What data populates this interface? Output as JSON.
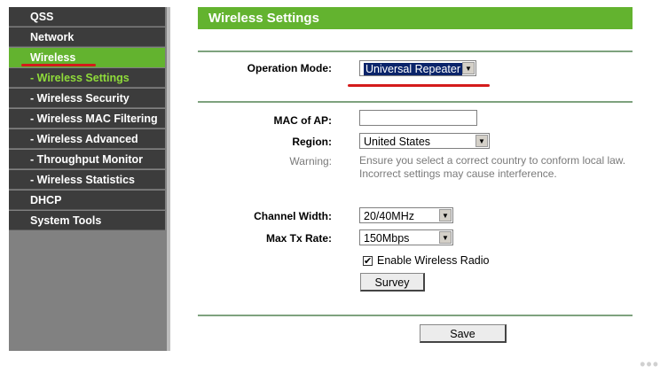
{
  "sidebar": {
    "items": [
      {
        "label": "QSS"
      },
      {
        "label": "Network"
      },
      {
        "label": "Wireless"
      },
      {
        "label": "- Wireless Settings"
      },
      {
        "label": "- Wireless Security"
      },
      {
        "label": "- Wireless MAC Filtering"
      },
      {
        "label": "- Wireless Advanced"
      },
      {
        "label": "- Throughput Monitor"
      },
      {
        "label": "- Wireless Statistics"
      },
      {
        "label": "DHCP"
      },
      {
        "label": "System Tools"
      }
    ]
  },
  "page": {
    "title": "Wireless Settings",
    "operation_mode": {
      "label": "Operation Mode:",
      "value": "Universal Repeater"
    },
    "mac_of_ap": {
      "label": "MAC of AP:",
      "value": ""
    },
    "region": {
      "label": "Region:",
      "value": "United States"
    },
    "warning": {
      "label": "Warning:",
      "line1": "Ensure you select a correct country to conform local law.",
      "line2": "Incorrect settings may cause interference."
    },
    "channel_width": {
      "label": "Channel Width:",
      "value": "20/40MHz"
    },
    "max_tx_rate": {
      "label": "Max Tx Rate:",
      "value": "150Mbps"
    },
    "enable_radio": {
      "label": "Enable Wireless Radio",
      "checked": true,
      "mark": "✔"
    },
    "survey_button": "Survey",
    "save_button": "Save"
  },
  "colors": {
    "accent": "#63b32f",
    "highlight": "#d41b1b"
  },
  "icons": {
    "dropdown": "chevron-down-icon",
    "more": "more-dots-icon"
  },
  "decor": {
    "dots": "•••"
  }
}
